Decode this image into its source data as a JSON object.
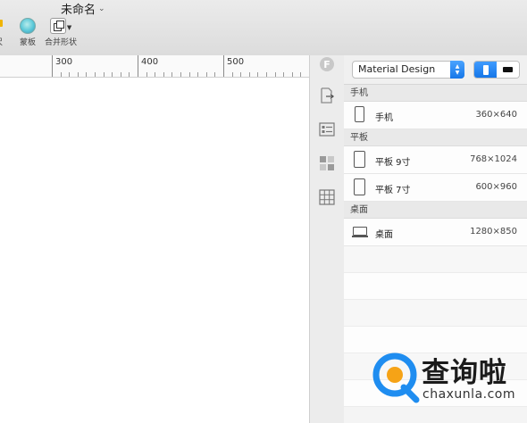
{
  "window": {
    "title": "未命名"
  },
  "toolbar": {
    "ruler_label": "标尺",
    "ruler_label_visible": "尺",
    "mask_label": "蒙板",
    "combine_label": "合并形状",
    "icons": {
      "ruler": "ruler-icon",
      "mask": "mask-icon",
      "combine": "combine-shapes-icon"
    },
    "accent": "#f0b400"
  },
  "ruler": {
    "ticks": [
      "300",
      "400",
      "500"
    ]
  },
  "sidebar_strip": {
    "icons": [
      "plugin-logo-icon",
      "export-icon",
      "properties-list-icon",
      "components-icon",
      "grid-icon"
    ]
  },
  "panel": {
    "preset_select": "Material Design",
    "orientation": {
      "selected": "portrait",
      "accent": "#1677e8"
    },
    "sections": [
      {
        "title": "手机",
        "devices": [
          {
            "name": "手机",
            "size": "360×640",
            "icon": "phone-icon"
          }
        ]
      },
      {
        "title": "平板",
        "devices": [
          {
            "name": "平板 9寸",
            "size": "768×1024",
            "icon": "tablet-icon"
          },
          {
            "name": "平板 7寸",
            "size": "600×960",
            "icon": "tablet-icon"
          }
        ]
      },
      {
        "title": "桌面",
        "devices": [
          {
            "name": "桌面",
            "size": "1280×850",
            "icon": "laptop-icon"
          }
        ]
      }
    ]
  },
  "watermark": {
    "brand": "查询啦",
    "url": "chaxunla.com",
    "color": "#1f8df0"
  }
}
